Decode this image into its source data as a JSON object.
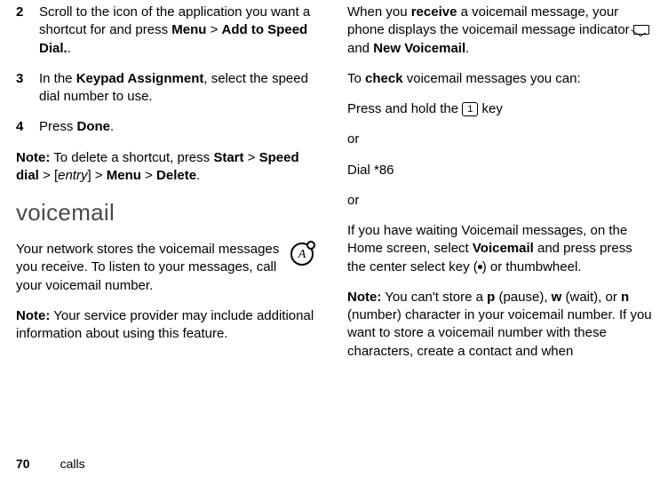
{
  "left": {
    "step2": {
      "num": "2",
      "t1": "Scroll to the icon of the application you want a shortcut for and press ",
      "menu": "Menu",
      "gt1": " > ",
      "add": "Add to Speed Dial.",
      "t2": "."
    },
    "step3": {
      "num": "3",
      "t1": "In the ",
      "ka": "Keypad Assignment",
      "t2": ", select the speed dial number to use."
    },
    "step4": {
      "num": "4",
      "t1": "Press ",
      "done": "Done",
      "t2": "."
    },
    "note": {
      "label": "Note:",
      "t1": " To delete a shortcut, press ",
      "start": "Start",
      "gt1": " > ",
      "sd": "Speed dial",
      "gt2": " > [",
      "entry": "entry",
      "brk": "] > ",
      "menu": "Menu",
      "gt3": " > ",
      "del": "Delete",
      "t2": "."
    },
    "heading": "voicemail",
    "p1": "Your network stores the voicemail messages you receive. To listen to your messages, call your voicemail number.",
    "p2": {
      "label": "Note:",
      "t": " Your service provider may include additional information about using this feature."
    },
    "iconLetter": "A"
  },
  "right": {
    "p1": {
      "t1": "When you ",
      "recv": "receive",
      "t2": " a voicemail message, your phone displays the voicemail message indicator ",
      "t3": " and ",
      "nv": "New Voicemail",
      "t4": "."
    },
    "p2": {
      "t1": "To ",
      "chk": "check",
      "t2": " voicemail messages you can:"
    },
    "p3": {
      "t1": "Press and hold the ",
      "key": "1",
      "t2": " key"
    },
    "or1": "or",
    "p4": "Dial *86",
    "or2": "or",
    "p5": {
      "t1": "If you have waiting Voicemail messages, on the Home screen, select ",
      "vm": "Voicemail",
      "t2": " and press press the center select key (",
      "t3": ") or thumbwheel."
    },
    "p6": {
      "label": "Note:",
      "t1": " You can't store a ",
      "p": "p",
      "pt": " (pause), ",
      "w": "w",
      "wt": " (wait), or ",
      "n": "n",
      "nt": " (number) character in your voicemail number. If you want to store a voicemail number with these characters, create a contact and when"
    }
  },
  "footer": {
    "page": "70",
    "section": "calls"
  }
}
